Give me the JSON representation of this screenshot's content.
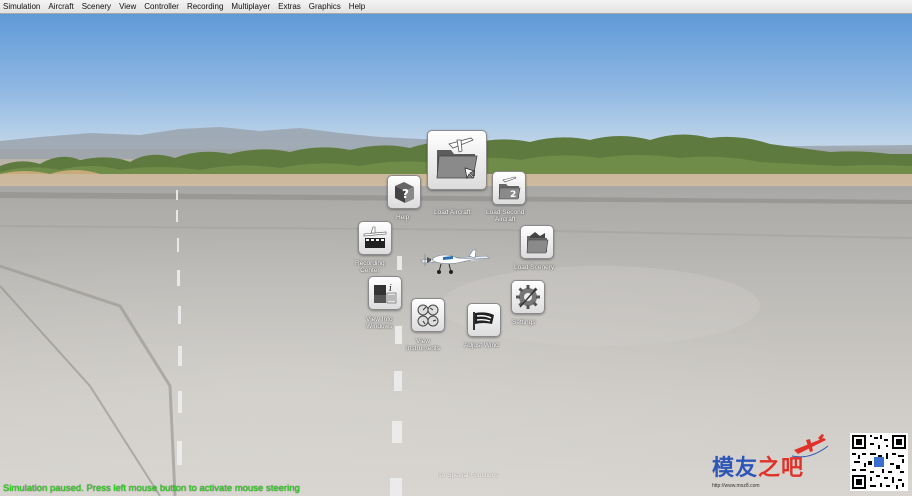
{
  "menubar": {
    "items": [
      "Simulation",
      "Aircraft",
      "Scenery",
      "View",
      "Controller",
      "Recording",
      "Multiplayer",
      "Extras",
      "Graphics",
      "Help"
    ]
  },
  "radial_menu": {
    "load_aircraft": "Load Aircraft",
    "help": "Help",
    "load_second_aircraft_line1": "Load Second",
    "load_second_aircraft_line2": "Aircraft",
    "recording_center_line1": "Recording",
    "recording_center_line2": "Center",
    "load_scenery": "Load Scenery",
    "view_info_windows_line1": "View Info",
    "view_info_windows_line2": "Windows",
    "settings": "Settings",
    "view_instruments_line1": "View",
    "view_instruments_line2": "Instruments",
    "adjust_wind": "Adjust Wind",
    "second_aircraft_badge": "2"
  },
  "status": {
    "message": "Simulation paused. Press left mouse button to activate mouse steering",
    "special_functions": "No Special Functions"
  },
  "watermark": {
    "text_part1": "模友",
    "text_part2": "之吧",
    "url": "http://www.moz8.com"
  },
  "colors": {
    "status_text": "#29d619",
    "watermark_blue": "#2e56b8",
    "watermark_red": "#e0322b"
  },
  "icons": [
    "load-aircraft-icon",
    "help-icon",
    "load-second-aircraft-icon",
    "recording-center-icon",
    "load-scenery-icon",
    "view-info-windows-icon",
    "settings-icon",
    "view-instruments-icon",
    "adjust-wind-icon",
    "airplane-model-icon",
    "qr-code-icon"
  ]
}
